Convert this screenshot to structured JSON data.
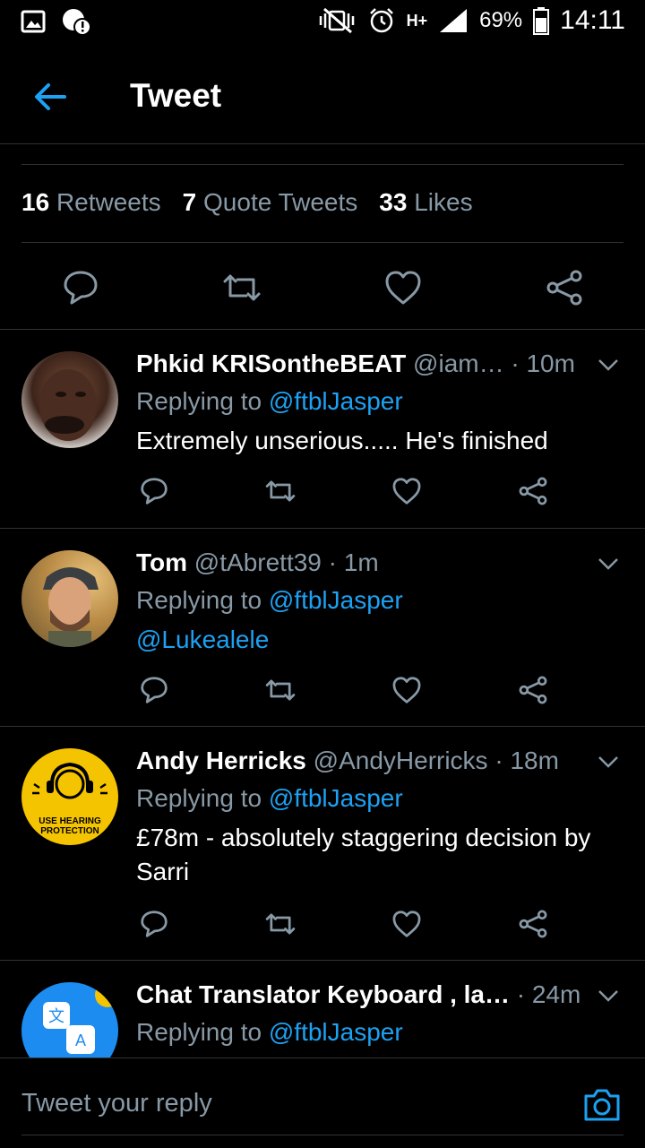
{
  "status_bar": {
    "battery": "69%",
    "time": "14:11",
    "network": "H+"
  },
  "header": {
    "title": "Tweet"
  },
  "stats": {
    "retweets_count": "16",
    "retweets_label": "Retweets",
    "quotes_count": "7",
    "quotes_label": "Quote Tweets",
    "likes_count": "33",
    "likes_label": "Likes"
  },
  "replies": [
    {
      "name": "Phkid KRISontheBEAT",
      "handle_time": " @iam… · 10m",
      "replying_prefix": "Replying to ",
      "replying_handle": "@ftblJasper",
      "text": "Extremely unserious..... He's finished"
    },
    {
      "name": "Tom",
      "handle_time": " @tAbrett39 · 1m",
      "replying_prefix": "Replying to ",
      "replying_handle": "@ftblJasper",
      "text": "@Lukealele"
    },
    {
      "name": "Andy Herricks",
      "handle_time": " @AndyHerricks · 18m",
      "replying_prefix": "Replying to ",
      "replying_handle": "@ftblJasper",
      "text": "£78m - absolutely staggering decision by Sarri",
      "avatar_text_1": "USE HEARING",
      "avatar_text_2": "PROTECTION"
    },
    {
      "name": "Chat Translator Keyboard , la…",
      "handle_time": " · 24m",
      "replying_prefix": "Replying to ",
      "replying_handle": "@ftblJasper"
    }
  ],
  "composer": {
    "placeholder": "Tweet your reply"
  },
  "colors": {
    "accent": "#1da1f2",
    "muted": "#8899a6",
    "divider": "#2f3336"
  }
}
